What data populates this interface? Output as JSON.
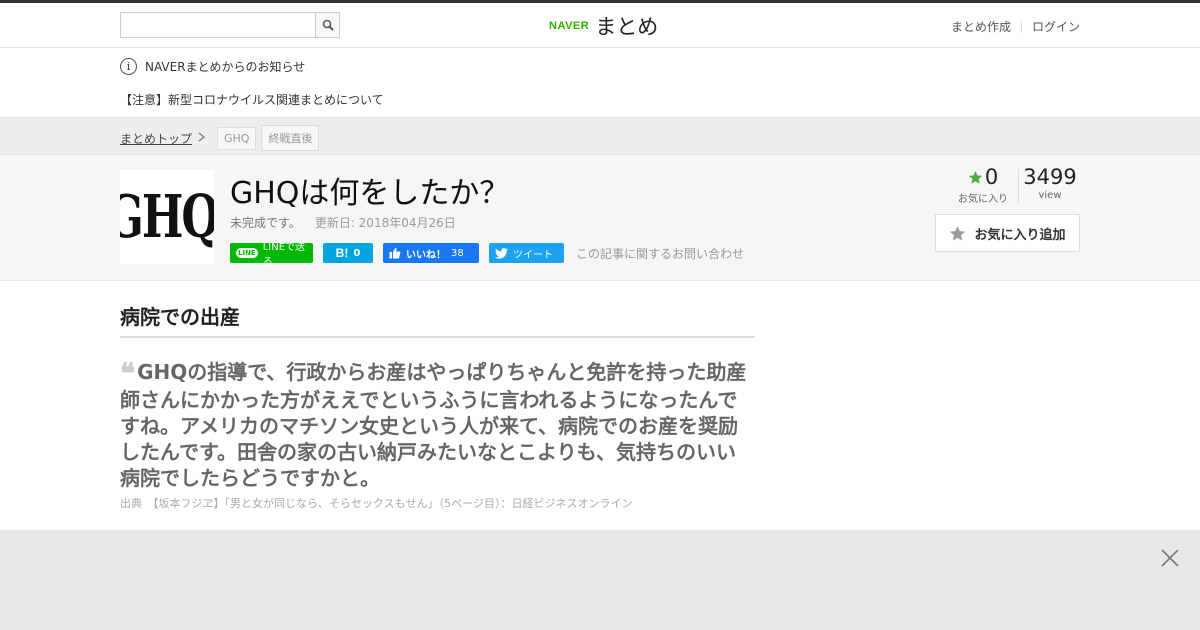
{
  "header": {
    "search_placeholder": "",
    "logo_brand": "NAVER",
    "logo_name": "まとめ",
    "create_label": "まとめ作成",
    "login_label": "ログイン"
  },
  "notice": {
    "title": "NAVERまとめからのお知らせ",
    "item": "【注意】新型コロナウイルス関連まとめについて"
  },
  "breadcrumb": {
    "top": "まとめトップ",
    "tags": [
      "GHQ",
      "終戦直後"
    ]
  },
  "article": {
    "thumb_text": "GHQ",
    "title": "GHQは何をしたか？",
    "status": "未完成です。",
    "updated": "更新日: 2018年04月26日",
    "share": {
      "line": "LINEで送る",
      "hatena_count": "0",
      "fb_label": "いいね！",
      "fb_count": "38",
      "tweet": "ツイート",
      "contact": "この記事に関するお問い合わせ"
    },
    "stats": {
      "fav_count": "0",
      "fav_label": "お気に入り",
      "view_count": "3499",
      "view_label": "view"
    },
    "fav_button": "お気に入り追加"
  },
  "content": {
    "section_heading": "病院での出産",
    "quote": "GHQの指導で、行政からお産はやっぱりちゃんと免許を持った助産師さんにかかった方がええでというふうに言われるようになったんですね。アメリカのマチソン女史という人が来て、病院でのお産を奨励したんです。田舎の家の古い納戸みたいなとこよりも、気持ちのいい病院でしたらどうですかと。",
    "source": "出典　【坂本フジヱ】「男と女が同じなら、そらセックスもせん」（5ページ目）：日経ビジネスオンライン"
  },
  "colors": {
    "naver_green": "#2db400",
    "line_green": "#00b900",
    "hatena_blue": "#00a4de",
    "facebook_blue": "#1877f2",
    "twitter_blue": "#1da1f2",
    "star_green": "#4cae3a"
  }
}
